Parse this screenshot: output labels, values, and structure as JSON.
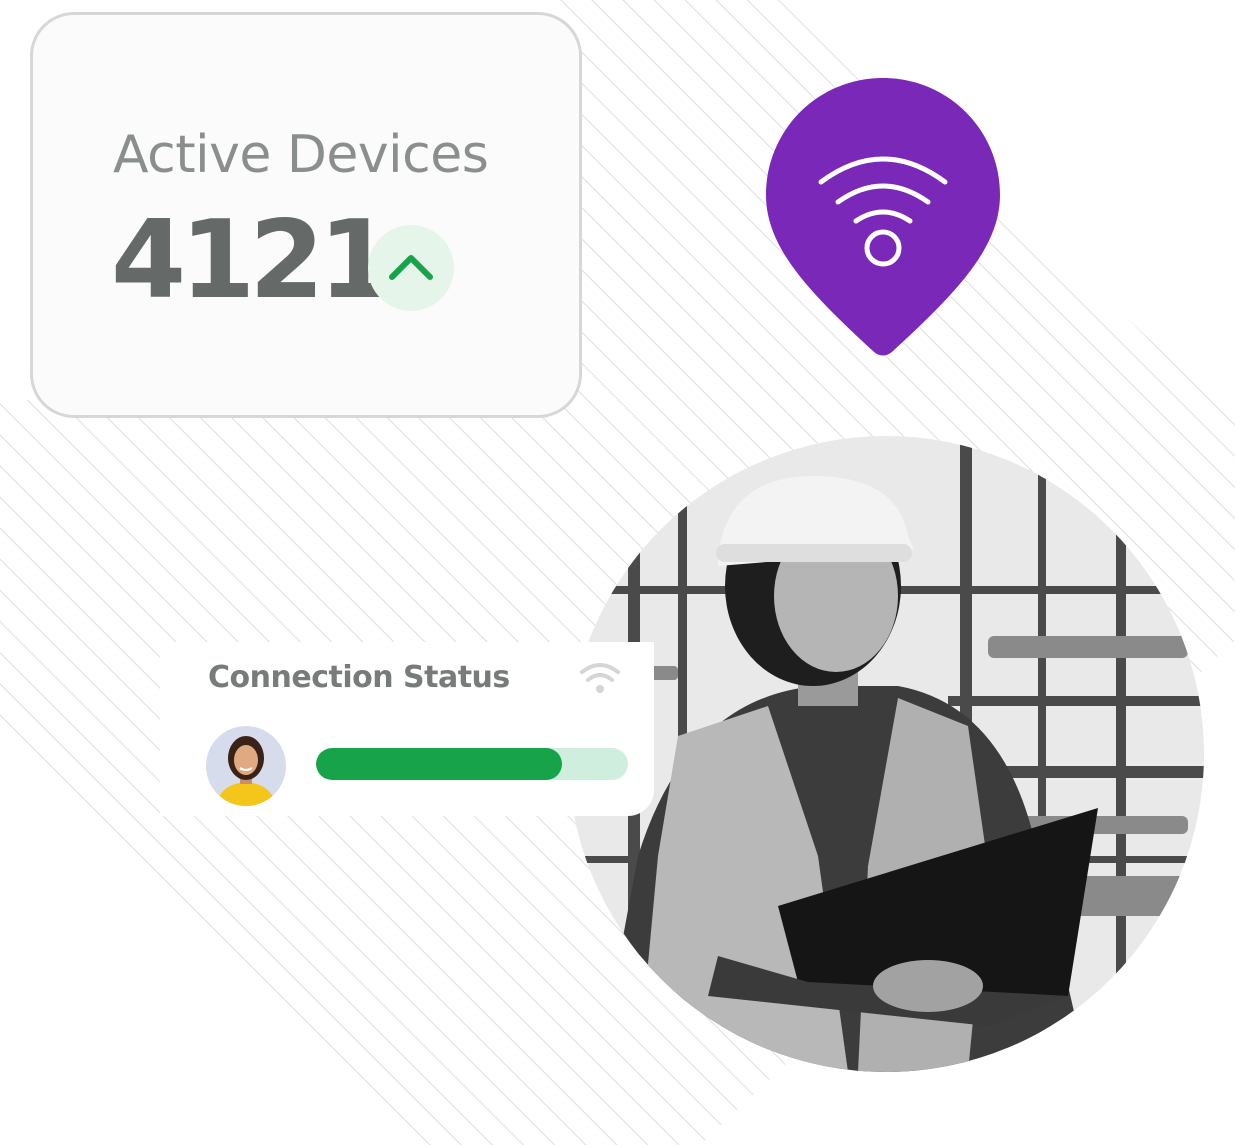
{
  "active_devices": {
    "title": "Active Devices",
    "count": "4121",
    "trend": "up",
    "trend_icon": "chevron-up-icon"
  },
  "location_pin": {
    "icon": "wifi-icon",
    "color": "#7a28b8"
  },
  "connection_status": {
    "title": "Connection Status",
    "icon": "wifi-icon",
    "progress_percent": 79,
    "bar_color": "#16a34a",
    "track_color": "#cfeedd"
  },
  "colors": {
    "success": "#16a34a",
    "badge_bg": "#e6f5ea",
    "stripe": "#dcdfdd"
  }
}
